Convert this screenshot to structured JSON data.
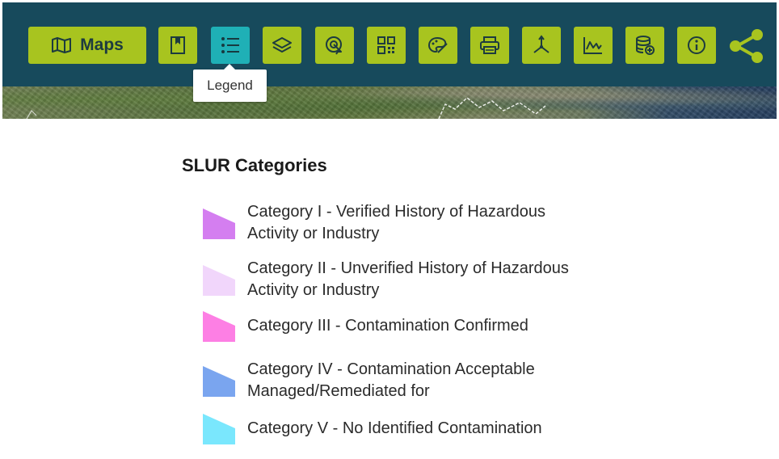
{
  "toolbar": {
    "maps_label": "Maps",
    "tooltip": "Legend",
    "buttons": [
      {
        "icon": "bookmark-icon"
      },
      {
        "icon": "legend-list-icon",
        "active": true
      },
      {
        "icon": "layers-icon"
      },
      {
        "icon": "locate-touch-icon"
      },
      {
        "icon": "qr-grid-icon"
      },
      {
        "icon": "palette-brush-icon"
      },
      {
        "icon": "print-icon"
      },
      {
        "icon": "coordinate-axes-icon"
      },
      {
        "icon": "line-chart-icon"
      },
      {
        "icon": "database-add-icon"
      },
      {
        "icon": "info-icon"
      }
    ],
    "share_icon": "share-icon"
  },
  "colors": {
    "toolbar_bg": "#174a5c",
    "button_bg": "#a8c41f",
    "button_active_bg": "#1fb0b6"
  },
  "legend": {
    "title": "SLUR Categories",
    "items": [
      {
        "label": "Category I - Verified History of Hazardous Activity or Industry",
        "color": "#d47ef0"
      },
      {
        "label": "Category II - Unverified History of Hazardous Activity or Industry",
        "color": "#f1d6fb"
      },
      {
        "label": "Category III - Contamination Confirmed",
        "color": "#fd7fe4"
      },
      {
        "label": "Category IV - Contamination Acceptable Managed/Remediated for",
        "color": "#7aa5ef"
      },
      {
        "label": "Category V - No Identified Contamination",
        "color": "#7ae7fd"
      }
    ]
  }
}
